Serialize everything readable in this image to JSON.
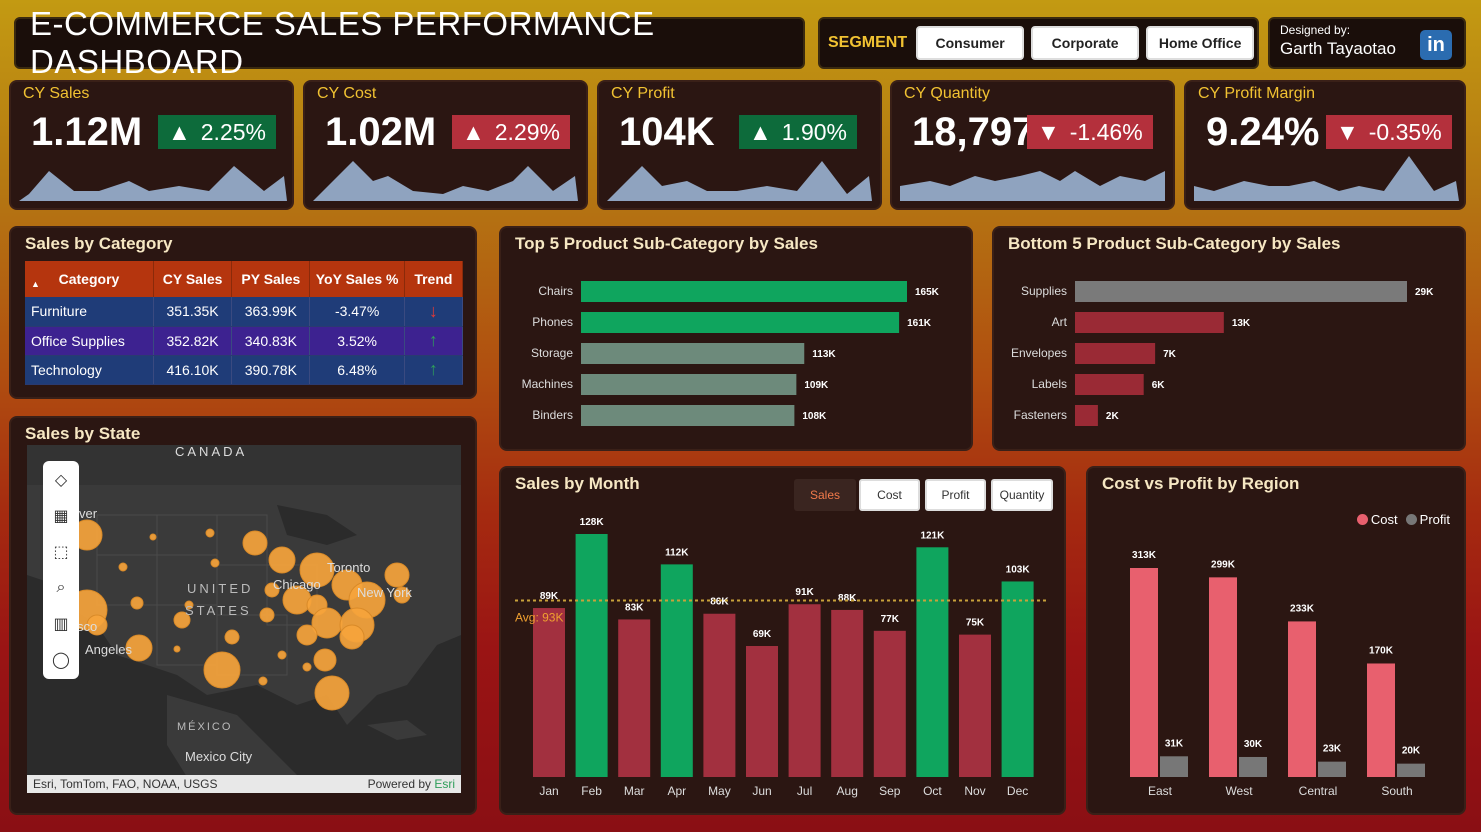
{
  "header": {
    "title": "E-COMMERCE SALES PERFORMANCE DASHBOARD",
    "segment_label": "SEGMENT",
    "segments": [
      "Consumer",
      "Corporate",
      "Home Office"
    ],
    "designer_by": "Designed by:",
    "designer_name": "Garth Tayaotao",
    "linkedin": "in"
  },
  "kpis": [
    {
      "label": "CY Sales",
      "value": "1.12M",
      "change": "2.25%",
      "dir": "up",
      "arrow": "▲"
    },
    {
      "label": "CY Cost",
      "value": "1.02M",
      "change": "2.29%",
      "dir": "down",
      "arrow": "▲"
    },
    {
      "label": "CY Profit",
      "value": "104K",
      "change": "1.90%",
      "dir": "up",
      "arrow": "▲"
    },
    {
      "label": "CY Quantity",
      "value": "18,797",
      "change": "-1.46%",
      "dir": "down",
      "arrow": "▼"
    },
    {
      "label": "CY Profit Margin",
      "value": "9.24%",
      "change": "-0.35%",
      "dir": "down",
      "arrow": "▼"
    }
  ],
  "category_table": {
    "title": "Sales by Category",
    "headers": [
      "Category",
      "CY Sales",
      "PY Sales",
      "YoY Sales %",
      "Trend"
    ],
    "rows": [
      {
        "category": "Furniture",
        "cy": "351.35K",
        "py": "363.99K",
        "yoy": "-3.47%",
        "trend": "↓",
        "trend_color": "#e53935"
      },
      {
        "category": "Office Supplies",
        "cy": "352.82K",
        "py": "340.83K",
        "yoy": "3.52%",
        "trend": "↑",
        "trend_color": "#2e9e5a"
      },
      {
        "category": "Technology",
        "cy": "416.10K",
        "py": "390.78K",
        "yoy": "6.48%",
        "trend": "↑",
        "trend_color": "#2e9e5a"
      }
    ]
  },
  "map": {
    "title": "Sales by State",
    "labels": [
      "CANADA",
      "UNITED",
      "STATES",
      "Toronto",
      "Chicago",
      "New York",
      "Angeles",
      "sco",
      "ver",
      "MÉXICO",
      "Mexico City"
    ],
    "attribution": "Esri, TomTom, FAO, NOAA, USGS",
    "powered_by": "Powered by ",
    "esri": "Esri"
  },
  "top5": {
    "title": "Top 5 Product Sub-Category by Sales",
    "color": "#0fa55e"
  },
  "bottom5": {
    "title": "Bottom 5 Product Sub-Category by Sales",
    "color": "#9a2a35"
  },
  "monthly": {
    "title": "Sales by Month",
    "toggles": [
      "Sales",
      "Cost",
      "Profit",
      "Quantity"
    ],
    "avg_label": "Avg: 93K",
    "high_color": "#0fa55e",
    "low_color": "#a2303f"
  },
  "region": {
    "title": "Cost vs Profit by Region",
    "legend_cost": "Cost",
    "legend_profit": "Profit",
    "cost_color": "#e8606e",
    "profit_color": "#777777"
  },
  "chart_data": [
    {
      "type": "bar",
      "title": "Top 5 Product Sub-Category by Sales",
      "orientation": "horizontal",
      "categories": [
        "Chairs",
        "Phones",
        "Storage",
        "Machines",
        "Binders"
      ],
      "values": [
        165,
        161,
        113,
        109,
        108
      ],
      "labels": [
        "165K",
        "161K",
        "113K",
        "109K",
        "108K"
      ],
      "colors": [
        "#0fa55e",
        "#0fa55e",
        "#6d8a7b",
        "#6d8a7b",
        "#6d8a7b"
      ]
    },
    {
      "type": "bar",
      "title": "Bottom 5 Product Sub-Category by Sales",
      "orientation": "horizontal",
      "categories": [
        "Supplies",
        "Art",
        "Envelopes",
        "Labels",
        "Fasteners"
      ],
      "values": [
        29,
        13,
        7,
        6,
        2
      ],
      "labels": [
        "29K",
        "13K",
        "7K",
        "6K",
        "2K"
      ],
      "colors": [
        "#7a7a7a",
        "#9a2a35",
        "#9a2a35",
        "#9a2a35",
        "#9a2a35"
      ]
    },
    {
      "type": "bar",
      "title": "Sales by Month",
      "categories": [
        "Jan",
        "Feb",
        "Mar",
        "Apr",
        "May",
        "Jun",
        "Jul",
        "Aug",
        "Sep",
        "Oct",
        "Nov",
        "Dec"
      ],
      "values": [
        89,
        128,
        83,
        112,
        86,
        69,
        91,
        88,
        77,
        121,
        75,
        103
      ],
      "labels": [
        "89K",
        "128K",
        "83K",
        "112K",
        "86K",
        "69K",
        "91K",
        "88K",
        "77K",
        "121K",
        "75K",
        "103K"
      ],
      "average": 93,
      "ylim": [
        0,
        135
      ]
    },
    {
      "type": "bar",
      "title": "Cost vs Profit by Region",
      "categories": [
        "East",
        "West",
        "Central",
        "South"
      ],
      "series": [
        {
          "name": "Cost",
          "values": [
            313,
            299,
            233,
            170
          ],
          "labels": [
            "313K",
            "299K",
            "233K",
            "170K"
          ]
        },
        {
          "name": "Profit",
          "values": [
            31,
            30,
            23,
            20
          ],
          "labels": [
            "31K",
            "30K",
            "23K",
            "20K"
          ]
        }
      ],
      "ylim": [
        0,
        330
      ]
    }
  ]
}
